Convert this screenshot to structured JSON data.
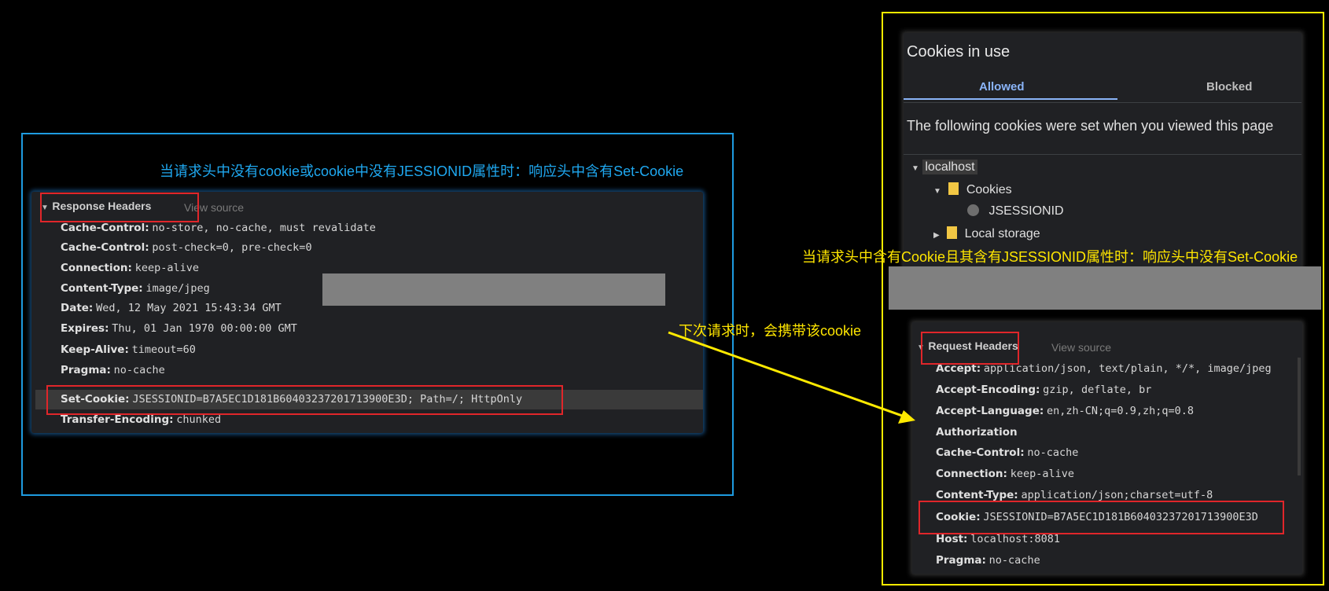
{
  "left_note": "当请求头中没有cookie或cookie中没有JESSIONID属性时：响应头中含有Set-Cookie",
  "response_headers": {
    "title": "Response Headers",
    "view_source": "View source",
    "rows": [
      {
        "key": "Cache-Control:",
        "value": "no-store, no-cache, must revalidate"
      },
      {
        "key": "Cache-Control:",
        "value": "post-check=0, pre-check=0"
      },
      {
        "key": "Connection:",
        "value": "keep-alive"
      },
      {
        "key": "Content-Type:",
        "value": "image/jpeg"
      },
      {
        "key": "Date:",
        "value": "Wed, 12 May 2021 15:43:34 GMT"
      },
      {
        "key": "Expires:",
        "value": "Thu, 01 Jan 1970 00:00:00 GMT"
      },
      {
        "key": "Keep-Alive:",
        "value": "timeout=60"
      },
      {
        "key": "Pragma:",
        "value": "no-cache"
      },
      {
        "key": "Set-Cookie:",
        "value": "JSESSIONID=B7A5EC1D181B60403237201713900E3D; Path=/; HttpOnly"
      },
      {
        "key": "Transfer-Encoding:",
        "value": "chunked"
      }
    ]
  },
  "cookies_in_use": {
    "title": "Cookies in use",
    "tabs": [
      "Allowed",
      "Blocked"
    ],
    "description": "The following cookies were set when you viewed this page",
    "tree": {
      "host": "localhost",
      "cookies_label": "Cookies",
      "cookie_name": "JSESSIONID",
      "local_storage": "Local storage"
    }
  },
  "right_note": "当请求头中含有Cookie且其含有JSESSIONID属性时：响应头中没有Set-Cookie",
  "arrow_note": "下次请求时，会携带该cookie",
  "request_headers": {
    "title": "Request Headers",
    "view_source": "View source",
    "rows": [
      {
        "key": "Accept:",
        "value": "application/json, text/plain, */*, image/jpeg"
      },
      {
        "key": "Accept-Encoding:",
        "value": "gzip, deflate, br"
      },
      {
        "key": "Accept-Language:",
        "value": "en,zh-CN;q=0.9,zh;q=0.8"
      },
      {
        "key": "Authorization",
        "value": ""
      },
      {
        "key": "Cache-Control:",
        "value": "no-cache"
      },
      {
        "key": "Connection:",
        "value": "keep-alive"
      },
      {
        "key": "Content-Type:",
        "value": "application/json;charset=utf-8"
      },
      {
        "key": "Cookie:",
        "value": "JSESSIONID=B7A5EC1D181B60403237201713900E3D"
      },
      {
        "key": "Host:",
        "value": "localhost:8081"
      },
      {
        "key": "Pragma:",
        "value": "no-cache"
      }
    ]
  },
  "colors": {
    "left_accent": "#1e9be0",
    "right_accent": "#ffea00",
    "highlight_box": "#e0262a",
    "tab_active": "#8ab4f8"
  }
}
